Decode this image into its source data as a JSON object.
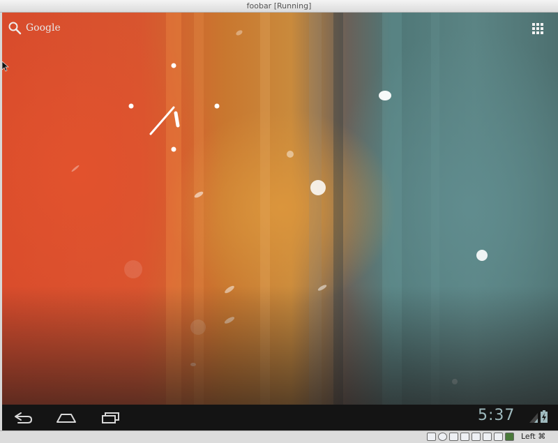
{
  "window": {
    "title": "foobar [Running]"
  },
  "search": {
    "label": "Google"
  },
  "statusbar": {
    "time": "5:37"
  },
  "host": {
    "host_key_label": "Left ⌘"
  },
  "colors": {
    "accent_clock": "#9eb9bd",
    "navbar": "#141414"
  }
}
